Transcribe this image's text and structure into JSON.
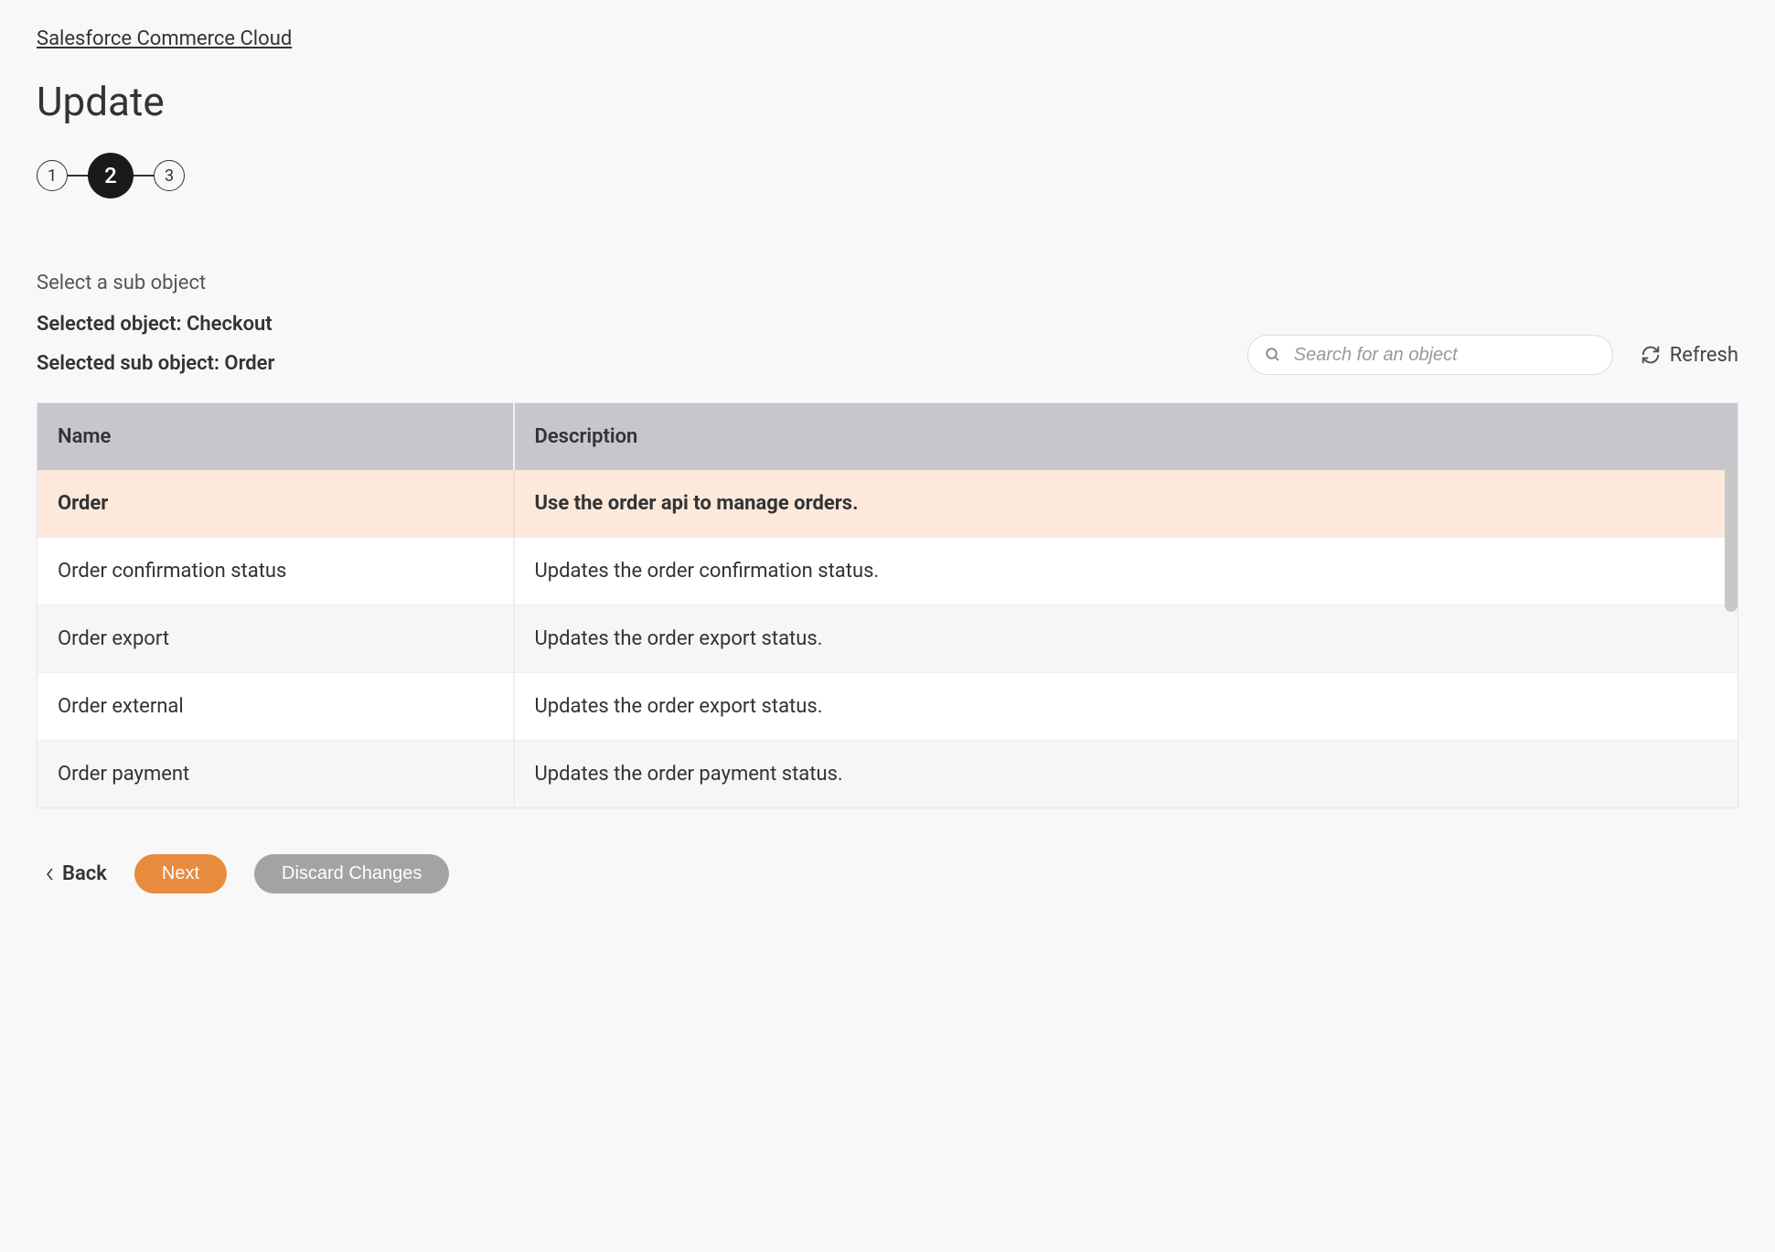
{
  "breadcrumb": "Salesforce Commerce Cloud",
  "page_title": "Update",
  "steps": {
    "s1": "1",
    "s2": "2",
    "s3": "3"
  },
  "sub_label": "Select a sub object",
  "selected_object_label": "Selected object: Checkout",
  "selected_sub_object_label": "Selected sub object: Order",
  "search": {
    "placeholder": "Search for an object"
  },
  "refresh_label": "Refresh",
  "table": {
    "headers": {
      "name": "Name",
      "description": "Description"
    },
    "rows": [
      {
        "name": "Order",
        "description": "Use the order api to manage orders."
      },
      {
        "name": "Order confirmation status",
        "description": "Updates the order confirmation status."
      },
      {
        "name": "Order export",
        "description": "Updates the order export status."
      },
      {
        "name": "Order external",
        "description": "Updates the order export status."
      },
      {
        "name": "Order payment",
        "description": "Updates the order payment status."
      }
    ]
  },
  "actions": {
    "back": "Back",
    "next": "Next",
    "discard": "Discard Changes"
  }
}
